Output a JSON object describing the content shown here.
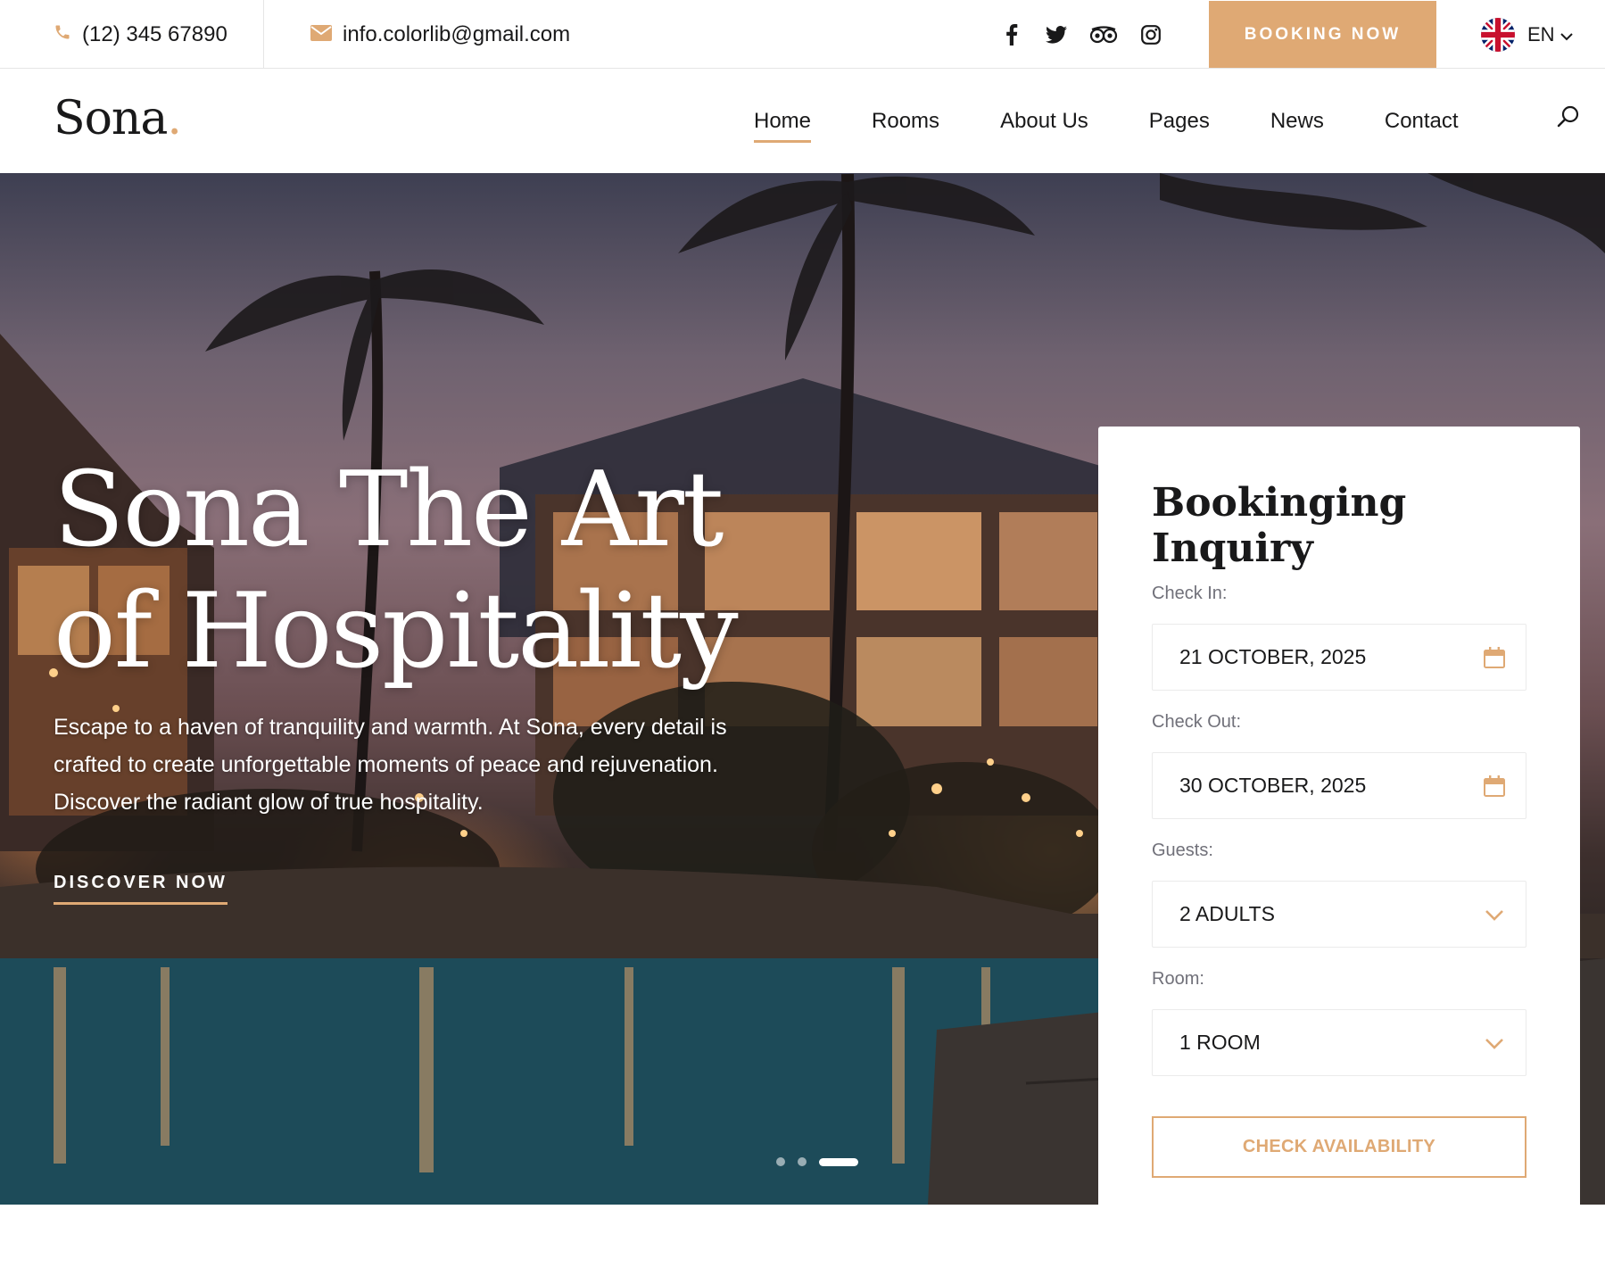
{
  "topbar": {
    "phone": "(12) 345 67890",
    "email": "info.colorlib@gmail.com",
    "social_icons": [
      "facebook-icon",
      "twitter-icon",
      "tripadvisor-icon",
      "instagram-icon"
    ],
    "booking_button": "BOOKING NOW",
    "language": "EN"
  },
  "header": {
    "logo_text": "Sona",
    "logo_dot": ".",
    "nav": {
      "home": "Home",
      "rooms": "Rooms",
      "about": "About Us",
      "pages": "Pages",
      "news": "News",
      "contact": "Contact"
    },
    "active_nav": "Home"
  },
  "hero": {
    "title_line1": "Sona The Art",
    "title_line2": "of Hospitality",
    "description": "Escape to a haven of tranquility and warmth. At Sona, every detail is crafted to create unforgettable moments of peace and rejuvenation. Discover the radiant glow of true hospitality.",
    "cta": "DISCOVER NOW",
    "slide_count": 3,
    "active_slide": 3
  },
  "booking": {
    "title": "Bookinging Inquiry",
    "check_in_label": "Check In:",
    "check_in_value": "21 OCTOBER, 2025",
    "check_out_label": "Check Out:",
    "check_out_value": "30 OCTOBER, 2025",
    "guests_label": "Guests:",
    "guests_value": "2 ADULTS",
    "room_label": "Room:",
    "room_value": "1 ROOM",
    "submit": "CHECK AVAILABILITY"
  },
  "colors": {
    "accent": "#dfa974",
    "text_dark": "#19191a",
    "text_muted": "#707079"
  }
}
